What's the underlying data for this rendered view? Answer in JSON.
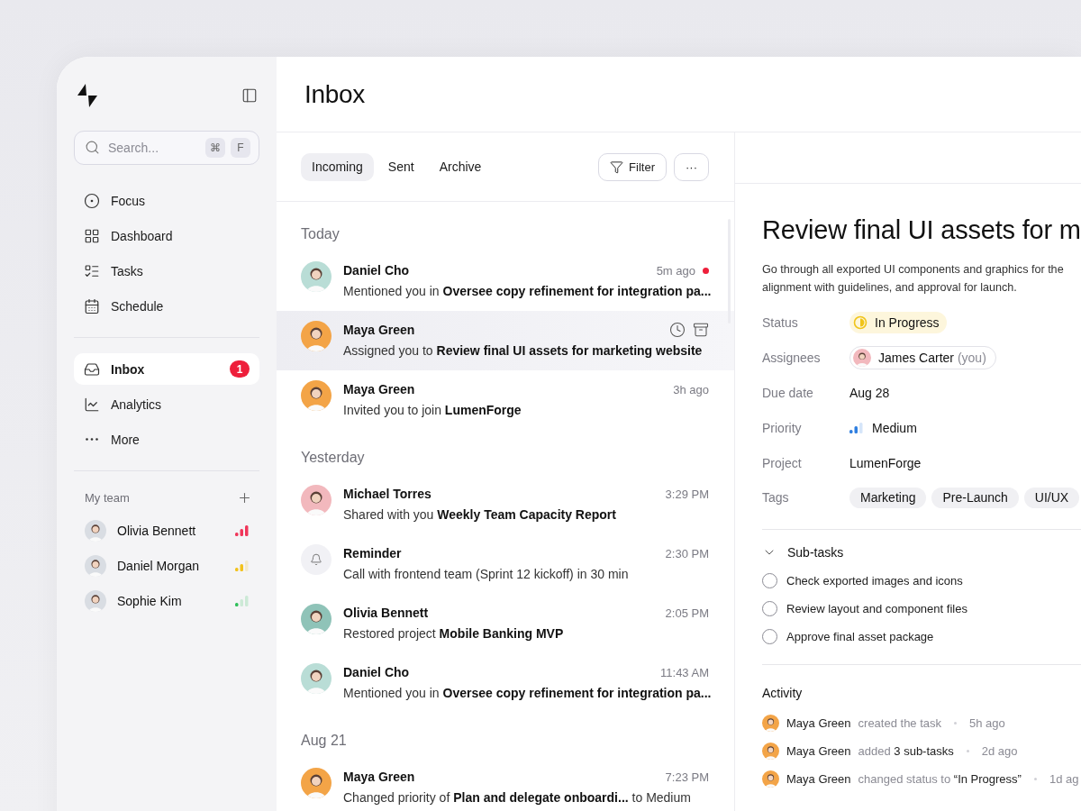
{
  "sidebar": {
    "search": {
      "placeholder": "Search...",
      "shortcut": [
        "⌘",
        "F"
      ]
    },
    "nav": [
      {
        "kind": "focus",
        "label": "Focus",
        "selected": false
      },
      {
        "kind": "dashboard",
        "label": "Dashboard",
        "selected": false
      },
      {
        "kind": "tasks",
        "label": "Tasks",
        "selected": false
      },
      {
        "kind": "schedule",
        "label": "Schedule",
        "selected": false
      }
    ],
    "nav2": [
      {
        "kind": "inbox",
        "label": "Inbox",
        "selected": true,
        "badge": "1"
      },
      {
        "kind": "analytics",
        "label": "Analytics",
        "selected": false
      },
      {
        "kind": "more",
        "label": "More",
        "selected": false
      }
    ],
    "team": {
      "title": "My team",
      "members": [
        {
          "name": "Olivia Bennett",
          "kind": "high",
          "color": "#f0365a"
        },
        {
          "name": "Daniel Morgan",
          "kind": "medium",
          "color": "#f2c21b"
        },
        {
          "name": "Sophie Kim",
          "kind": "low",
          "color": "#2fbf5a"
        }
      ]
    }
  },
  "header": {
    "title": "Inbox"
  },
  "inbox": {
    "tabs": [
      {
        "label": "Incoming",
        "selected": true
      },
      {
        "label": "Sent",
        "selected": false
      },
      {
        "label": "Archive",
        "selected": false
      }
    ],
    "filter": "Filter",
    "more": "···",
    "groups": [
      {
        "label": "Today",
        "items": [
          {
            "kind": "person",
            "color": "#b9ddd6",
            "sender": "Daniel Cho",
            "time": "5m ago",
            "text": "Mentioned you in **Oversee copy refinement for integration pa...**",
            "unread": true,
            "selected": false
          },
          {
            "kind": "person",
            "color": "#f3a447",
            "sender": "Maya Green",
            "text": "Assigned you to **Review final UI assets for marketing website**",
            "unread": false,
            "selected": true
          },
          {
            "kind": "person",
            "color": "#f3a447",
            "sender": "Maya Green",
            "time": "3h ago",
            "text": "Invited you to join **LumenForge**",
            "unread": false,
            "selected": false
          }
        ]
      },
      {
        "label": "Yesterday",
        "items": [
          {
            "kind": "person",
            "color": "#f2b8bd",
            "sender": "Michael Torres",
            "time": "3:29 PM",
            "text": "Shared with you **Weekly Team Capacity Report**",
            "unread": false,
            "selected": false
          },
          {
            "kind": "reminder",
            "sender": "Reminder",
            "time": "2:30 PM",
            "text": "Call with frontend team (Sprint 12 kickoff) in 30 min",
            "unread": false,
            "selected": false
          },
          {
            "kind": "person",
            "color": "#8fc3b8",
            "sender": "Olivia Bennett",
            "time": "2:05 PM",
            "text": "Restored project **Mobile Banking MVP**",
            "unread": false,
            "selected": false
          },
          {
            "kind": "person",
            "color": "#b9ddd6",
            "sender": "Daniel Cho",
            "time": "11:43 AM",
            "text": "Mentioned you in **Oversee copy refinement for integration pa...**",
            "unread": false,
            "selected": false
          }
        ]
      },
      {
        "label": "Aug 21",
        "items": [
          {
            "kind": "person",
            "color": "#f3a447",
            "sender": "Maya Green",
            "time": "7:23 PM",
            "text": "Changed priority of **Plan and delegate onboardi...** to Medium",
            "unread": false,
            "selected": false
          }
        ]
      }
    ]
  },
  "detail": {
    "title": "Review final UI assets for m",
    "description": "Go through all exported UI components and graphics for the alignment with guidelines, and approval for launch.",
    "properties": [
      {
        "kind": "status",
        "label": "Status",
        "value": "In Progress"
      },
      {
        "kind": "person",
        "label": "Assignees",
        "value": "James Carter",
        "suffix": "(you)",
        "color": "#f2b8bd"
      },
      {
        "kind": "text",
        "label": "Due date",
        "value": "Aug 28"
      },
      {
        "kind": "priority",
        "label": "Priority",
        "value": "Medium"
      },
      {
        "kind": "text",
        "label": "Project",
        "value": "LumenForge"
      },
      {
        "kind": "tags",
        "label": "Tags",
        "tags": [
          "Marketing",
          "Pre-Launch",
          "UI/UX"
        ]
      }
    ],
    "subtasks": {
      "title": "Sub-tasks",
      "expanded": true,
      "items": [
        {
          "label": "Check exported images and icons",
          "checked": false
        },
        {
          "label": "Review layout and component files",
          "checked": false
        },
        {
          "label": "Approve final asset package",
          "checked": false
        }
      ]
    },
    "activity": {
      "title": "Activity",
      "entries": [
        {
          "color": "#f3a447",
          "actor": "Maya Green",
          "action": "created the task",
          "time": "5h ago"
        },
        {
          "color": "#f3a447",
          "actor": "Maya Green",
          "action": "added **3 sub-tasks**",
          "time": "2d ago"
        },
        {
          "color": "#f3a447",
          "actor": "Maya Green",
          "action": "changed status to **“In Progress”**",
          "time": "1d ag"
        }
      ]
    }
  }
}
